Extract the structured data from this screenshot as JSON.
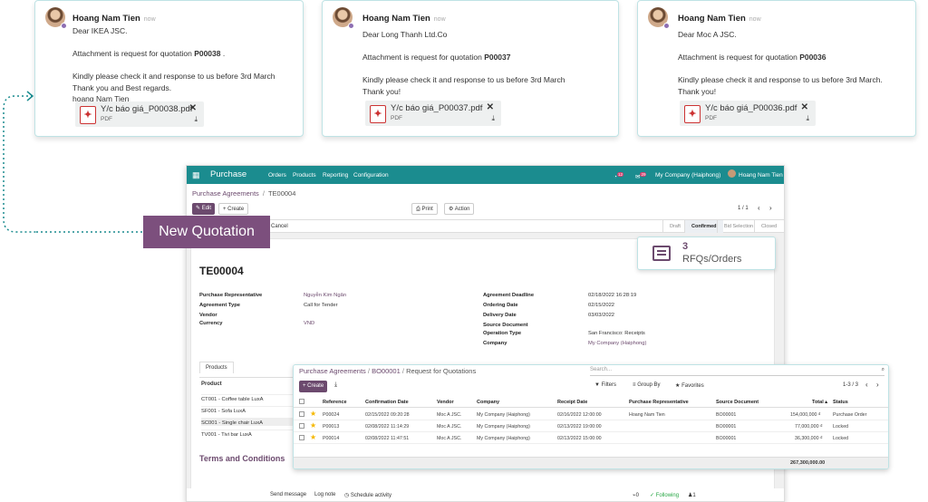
{
  "emails": [
    {
      "author": "Hoang Nam Tien",
      "when": "now",
      "lines": [
        "Dear IKEA JSC.",
        "",
        "Attachment is request for quotation {B}P00038{/B} .",
        "",
        "Kindly please check it and response to us before 3rd March",
        "Thank you and Best regards.",
        "hoang Nam Tien"
      ],
      "greeting": "Dear IKEA JSC.",
      "line_attach": "Attachment is request for quotation ",
      "po": "P00038",
      "line_attach_tail": " .",
      "line_kindly": "Kindly please check it and response to us before 3rd March",
      "line_thanks": "Thank you and Best regards.",
      "line_sign": "hoang Nam Tien",
      "attachment": {
        "name": "Y/c báo giá_P00038.pdf",
        "type": "PDF"
      }
    },
    {
      "author": "Hoang Nam Tien",
      "when": "now",
      "greeting": "Dear Long Thanh Ltd.Co",
      "line_attach": "Attachment is request for quotation ",
      "po": "P00037",
      "line_attach_tail": "",
      "line_kindly": "Kindly please check it and response to us before 3rd March",
      "line_thanks": "Thank you!",
      "attachment": {
        "name": "Y/c báo giá_P00037.pdf",
        "type": "PDF"
      }
    },
    {
      "author": "Hoang Nam Tien",
      "when": "now",
      "greeting": "Dear Moc A JSC.",
      "line_attach": "Attachment is request for quotation ",
      "po": "P00036",
      "line_attach_tail": "",
      "line_kindly": "Kindly please check it and response to us before 3rd March.",
      "line_thanks": "Thank you!",
      "attachment": {
        "name": "Y/c báo giá_P00036.pdf",
        "type": "PDF"
      }
    }
  ],
  "callout": "New Quotation",
  "rfq_button": {
    "count": "3",
    "label": "RFQs/Orders"
  },
  "odoo": {
    "app": "Purchase",
    "menu": [
      "Orders",
      "Products",
      "Reporting",
      "Configuration"
    ],
    "msg_badge": "12",
    "chat_badge": "29",
    "company": "My Company (Haiphong)",
    "user": "Hoang Nam Tien",
    "breadcrumb_root": "Purchase Agreements",
    "breadcrumb_sep": "/",
    "breadcrumb_current": "TE00004",
    "edit": "Edit",
    "create": "Create",
    "print": "Print",
    "action": "Action",
    "pager": "1 / 1",
    "cancel": "Cancel",
    "stages": [
      "Draft",
      "Confirmed",
      "Bid Selection",
      "Closed"
    ],
    "active_stage": "Confirmed",
    "record_name": "TE00004",
    "left_fields": [
      {
        "label": "Purchase Representative",
        "value": "Nguyễn Kim Ngân",
        "link": true
      },
      {
        "label": "Agreement Type",
        "value": "Call for Tender",
        "link": false
      },
      {
        "label": "Vendor",
        "value": "",
        "link": false
      },
      {
        "label": "Currency",
        "value": "VND",
        "link": true
      }
    ],
    "right_fields": [
      {
        "label": "Agreement Deadline",
        "value": "02/18/2022 16:28:19"
      },
      {
        "label": "Ordering Date",
        "value": "02/15/2022"
      },
      {
        "label": "Delivery Date",
        "value": "03/03/2022"
      },
      {
        "label": "Source Document",
        "value": ""
      },
      {
        "label": "Operation Type",
        "value": "San Francisco: Receipts"
      },
      {
        "label": "Company",
        "value": "My Company (Haiphong)"
      }
    ],
    "products_tab": "Products",
    "product_header": "Product",
    "products": [
      "CT001 - Coffee table LuxA",
      "SF001 - Sofa LuxA",
      "SC001 - Single chair LuxA",
      "TV001 - Tivi bar LuxA"
    ],
    "terms": "Terms and Conditions",
    "chatter": [
      "Send message",
      "Log note",
      "Schedule activity"
    ],
    "attachments_count": "0",
    "following": "Following",
    "followers": "1"
  },
  "rfq_list": {
    "breadcrumb": [
      "Purchase Agreements",
      "BO00001",
      "Request for Quotations"
    ],
    "sep": "/",
    "search_placeholder": "Search...",
    "create": "Create",
    "filters": "Filters",
    "group_by": "Group By",
    "favorites": "Favorites",
    "pager": "1-3 / 3",
    "columns": [
      "Reference",
      "Confirmation Date",
      "Vendor",
      "Company",
      "Receipt Date",
      "Purchase Representative",
      "Source Document",
      "Total",
      "Status"
    ],
    "rows": [
      {
        "ref": "P00024",
        "conf": "02/15/2022 09:20:28",
        "vendor": "Moc A JSC.",
        "company": "My Company (Haiphong)",
        "receipt": "02/16/2022 12:00:00",
        "rep": "Hoang Nam Tien",
        "src": "BO00001",
        "total": "154,000,000 ₫",
        "status": "Purchase Order"
      },
      {
        "ref": "P00013",
        "conf": "02/08/2022 11:14:29",
        "vendor": "Moc A JSC.",
        "company": "My Company (Haiphong)",
        "receipt": "02/13/2022 19:00:00",
        "rep": "",
        "src": "BO00001",
        "total": "77,000,000 ₫",
        "status": "Locked"
      },
      {
        "ref": "P00014",
        "conf": "02/08/2022 11:47:51",
        "vendor": "Moc A JSC.",
        "company": "My Company (Haiphong)",
        "receipt": "02/13/2022 15:00:00",
        "rep": "",
        "src": "BO00001",
        "total": "36,300,000 ₫",
        "status": "Locked"
      }
    ],
    "sum_total": "267,300,000.00"
  },
  "colors": {
    "teal": "#1b8c8f",
    "purple": "#6c4a6e",
    "callout": "#7c4f7d",
    "star": "#f5b800"
  }
}
